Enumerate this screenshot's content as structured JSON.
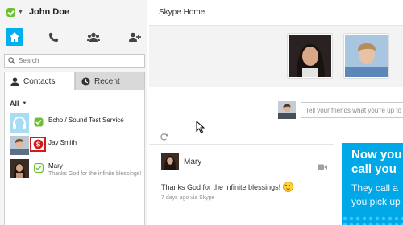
{
  "profile": {
    "name": "John Doe",
    "status_icon": "online-status-icon"
  },
  "nav": {
    "items": [
      {
        "icon": "home-icon"
      },
      {
        "icon": "phone-icon"
      },
      {
        "icon": "contacts-group-icon"
      },
      {
        "icon": "add-contact-icon"
      }
    ]
  },
  "search": {
    "placeholder": "Search"
  },
  "tabs": [
    {
      "label": "Contacts",
      "icon": "contacts-icon",
      "active": true
    },
    {
      "label": "Recent",
      "icon": "clock-icon",
      "active": false
    }
  ],
  "contacts": {
    "filter_label": "All",
    "items": [
      {
        "name": "Echo / Sound Test Service",
        "mood": "",
        "status": "online"
      },
      {
        "name": "Jay Smith",
        "mood": "",
        "status": "skype-highlighted"
      },
      {
        "name": "Mary",
        "mood": "Thanks God for the infinite blessings!",
        "status": "away"
      }
    ]
  },
  "main": {
    "title": "Skype Home",
    "post_placeholder": "Tell your friends what you're up to",
    "feed": {
      "name": "Mary",
      "message": "Thanks God for the infinite blessings!",
      "meta": "7 days ago via Skype"
    },
    "promo": {
      "headline_1": "Now you",
      "headline_2": "call you",
      "body_1": "They call a",
      "body_2": "you pick up"
    }
  },
  "colors": {
    "accent": "#00aff0",
    "online": "#6dbf2f",
    "highlight": "#d11a1a",
    "promo": "#00a8e8"
  }
}
